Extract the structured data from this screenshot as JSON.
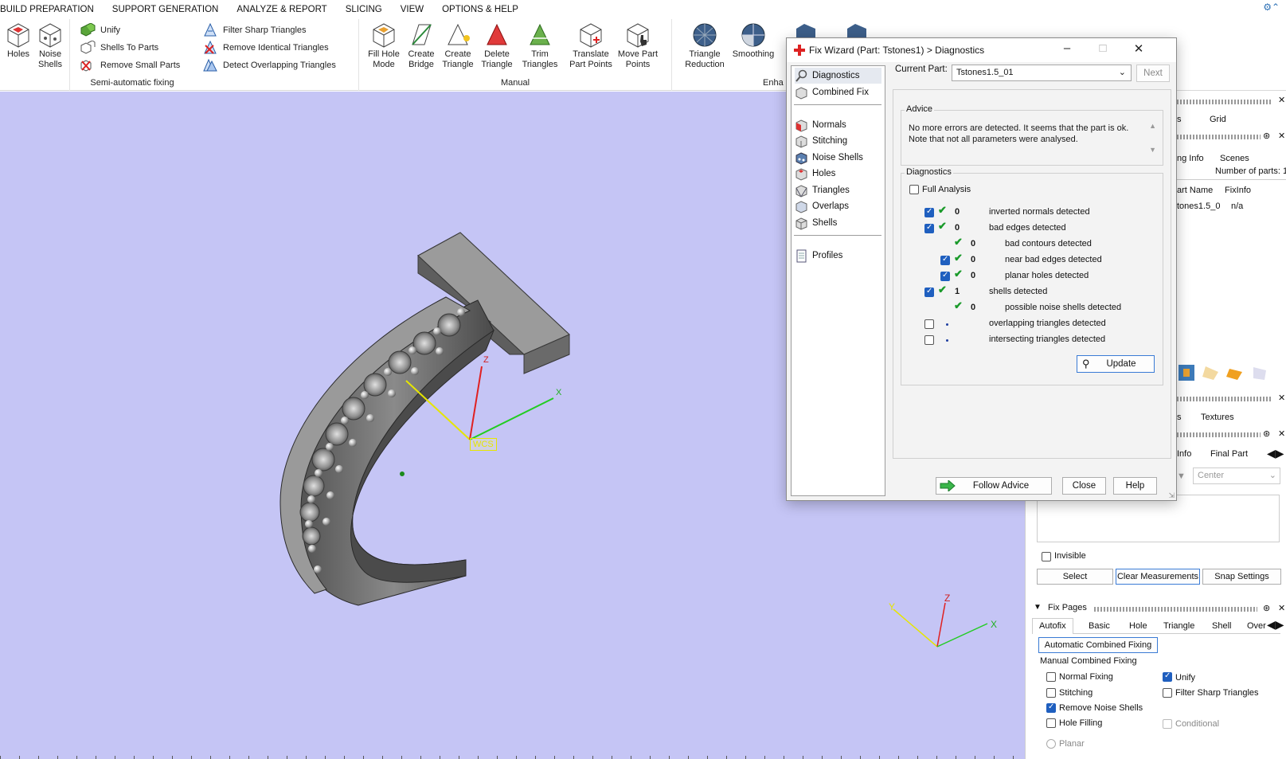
{
  "menu": {
    "items": [
      "BUILD PREPARATION",
      "SUPPORT GENERATION",
      "ANALYZE & REPORT",
      "SLICING",
      "VIEW",
      "OPTIONS & HELP"
    ]
  },
  "ribbon": {
    "group_first": {
      "holes": "Holes",
      "noise_shells_1": "Noise",
      "noise_shells_2": "Shells"
    },
    "semi_auto": {
      "unify": "Unify",
      "shells_to_parts": "Shells To Parts",
      "remove_small_parts": "Remove Small Parts",
      "filter_sharp": "Filter Sharp Triangles",
      "remove_identical": "Remove Identical Triangles",
      "detect_overlapping": "Detect Overlapping Triangles",
      "label": "Semi-automatic fixing"
    },
    "manual": {
      "fill_hole_mode": [
        "Fill Hole",
        "Mode"
      ],
      "create_bridge": [
        "Create",
        "Bridge"
      ],
      "create_triangle": [
        "Create",
        "Triangle"
      ],
      "delete_triangle": [
        "Delete",
        "Triangle"
      ],
      "trim_triangles": [
        "Trim",
        "Triangles"
      ],
      "translate_points": [
        "Translate",
        "Part Points"
      ],
      "move_points": [
        "Move Part",
        "Points"
      ],
      "label": "Manual"
    },
    "enhance": {
      "triangle_reduction": [
        "Triangle",
        "Reduction"
      ],
      "smoothing": "Smoothing",
      "label": "Enha"
    }
  },
  "viewport": {
    "wcs_label": "WCS",
    "axis_x": "X",
    "axis_y": "Y",
    "axis_z": "Z",
    "colors": {
      "background": "#c5c5f5",
      "x_axis": "#22cc22",
      "y_axis": "#e6e600",
      "z_axis": "#e02020"
    }
  },
  "dialog": {
    "title": "Fix Wizard (Part: Tstones1) > Diagnostics",
    "nav": {
      "diagnostics": "Diagnostics",
      "combined_fix": "Combined Fix",
      "normals": "Normals",
      "stitching": "Stitching",
      "noise_shells": "Noise Shells",
      "holes": "Holes",
      "triangles": "Triangles",
      "overlaps": "Overlaps",
      "shells": "Shells",
      "profiles": "Profiles"
    },
    "current_part_label": "Current Part:",
    "current_part_value": "Tstones1.5_01",
    "next": "Next",
    "advice_label": "Advice",
    "advice_text_1": "No more errors are detected. It seems that the part is ok.",
    "advice_text_2": "Note that not all parameters were analysed.",
    "diagnostics_label": "Diagnostics",
    "full_analysis": "Full Analysis",
    "rows": [
      {
        "count": "0",
        "label": "inverted normals detected"
      },
      {
        "count": "0",
        "label": "bad edges detected"
      },
      {
        "count": "0",
        "label": "bad contours detected"
      },
      {
        "count": "0",
        "label": "near bad edges detected"
      },
      {
        "count": "0",
        "label": "planar holes detected"
      },
      {
        "count": "1",
        "label": "shells detected"
      },
      {
        "count": "0",
        "label": "possible noise shells detected"
      },
      {
        "count": "",
        "label": "overlapping triangles detected"
      },
      {
        "count": "",
        "label": "intersecting triangles detected"
      }
    ],
    "update": "Update",
    "follow_advice": "Follow Advice",
    "close": "Close",
    "help": "Help"
  },
  "right_panel": {
    "tab_s": "s",
    "tab_grid": "Grid",
    "tab_ng_info": "ng Info",
    "tab_scenes": "Scenes",
    "num_parts": "Number of parts: 1",
    "col_part_name": "art Name",
    "col_fixinfo": "FixInfo",
    "row_part": "tones1.5_0",
    "row_fixinfo": "n/a",
    "tab_s2": "s",
    "tab_textures": "Textures",
    "tab_info": "Info",
    "tab_final_part": "Final Part",
    "center": "Center",
    "invisible": "Invisible",
    "select": "Select",
    "clear_measurements": "Clear Measurements",
    "snap_settings": "Snap Settings",
    "fix_pages": "Fix Pages",
    "fix_tabs": [
      "Autofix",
      "Basic",
      "Hole",
      "Triangle",
      "Shell",
      "Over"
    ],
    "auto_combined": "Automatic Combined Fixing",
    "manual_combined": "Manual Combined Fixing",
    "normal_fixing": "Normal Fixing",
    "unify": "Unify",
    "stitching": "Stitching",
    "filter_sharp": "Filter Sharp Triangles",
    "remove_noise": "Remove Noise Shells",
    "hole_filling": "Hole Filling",
    "conditional": "Conditional",
    "planar": "Planar"
  }
}
